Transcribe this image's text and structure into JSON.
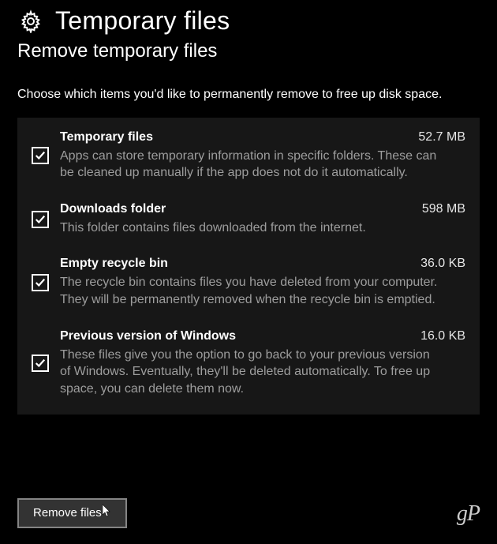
{
  "header": {
    "title": "Temporary files",
    "subtitle": "Remove temporary files",
    "instruction": "Choose which items you'd like to permanently remove to free up disk space."
  },
  "items": [
    {
      "title": "Temporary files",
      "size": "52.7 MB",
      "description": "Apps can store temporary information in specific folders. These can be cleaned up manually if the app does not do it automatically.",
      "checked": true
    },
    {
      "title": "Downloads folder",
      "size": "598 MB",
      "description": "This folder contains files downloaded from the internet.",
      "checked": true
    },
    {
      "title": "Empty recycle bin",
      "size": "36.0 KB",
      "description": "The recycle bin contains files you have deleted from your computer. They will be permanently removed when the recycle bin is emptied.",
      "checked": true
    },
    {
      "title": "Previous version of Windows",
      "size": "16.0 KB",
      "description": "These files give you the option to go back to your previous version of Windows. Eventually, they'll be deleted automatically. To free up space, you can delete them now.",
      "checked": true
    }
  ],
  "actions": {
    "remove_label": "Remove files"
  },
  "watermark": "gP"
}
